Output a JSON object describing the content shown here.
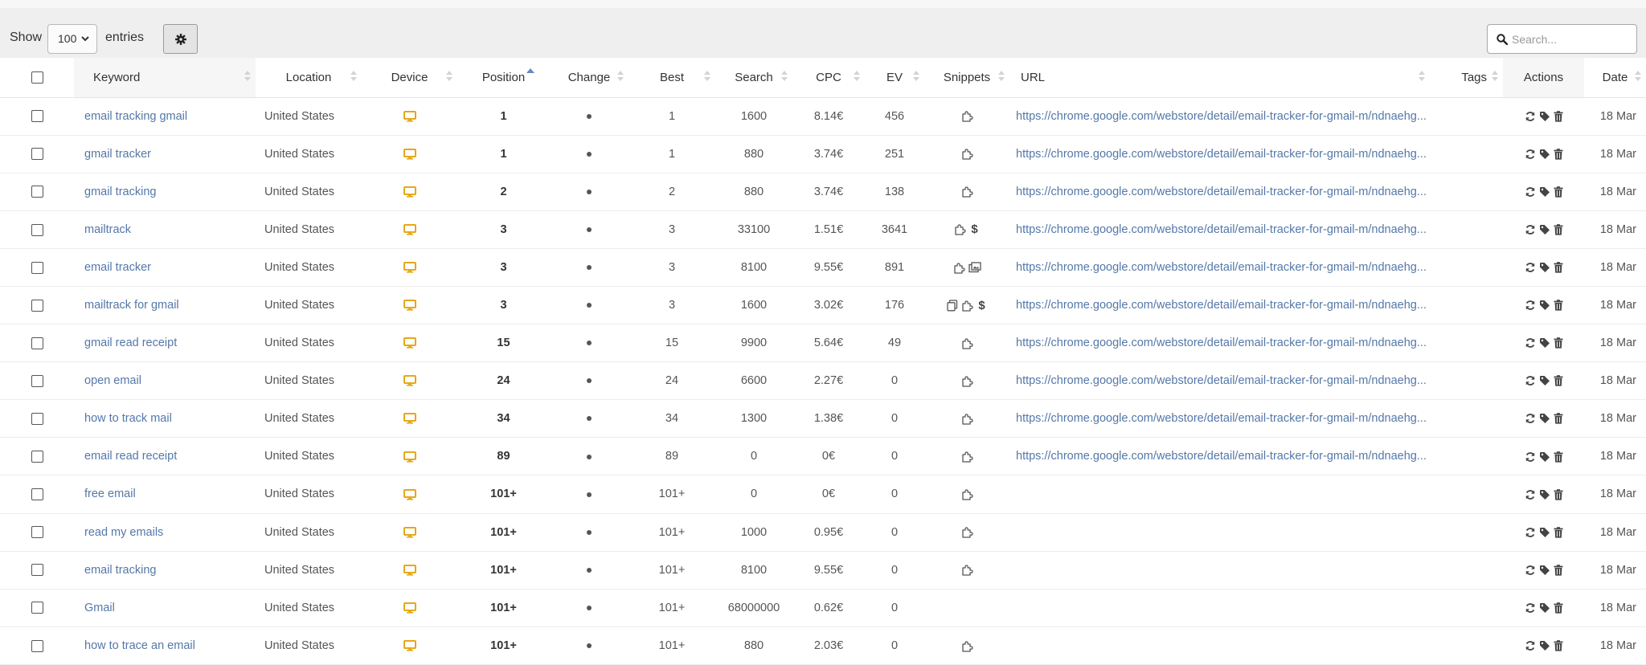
{
  "toolbar": {
    "show_label": "Show",
    "entries_value": "100",
    "entries_label": "entries",
    "settings_icon": "gear-icon",
    "search_placeholder": "Search..."
  },
  "columns": {
    "keyword": "Keyword",
    "location": "Location",
    "device": "Device",
    "position": "Position",
    "change": "Change",
    "best": "Best",
    "search": "Search",
    "cpc": "CPC",
    "ev": "EV",
    "snippets": "Snippets",
    "url": "URL",
    "tags": "Tags",
    "actions": "Actions",
    "date": "Date"
  },
  "colors": {
    "link": "#5478a8",
    "device_icon": "#e6a817",
    "sort_active": "#6c88c3"
  },
  "rows": [
    {
      "keyword": "email tracking gmail",
      "location": "United States",
      "device": "desktop-icon",
      "position": "1",
      "change": "dot",
      "best": "1",
      "search": "1600",
      "cpc": "8.14€",
      "ev": "456",
      "snippets": [
        "puzzle-icon"
      ],
      "url": "https://chrome.google.com/webstore/detail/email-tracker-for-gmail-m/ndnaehg...",
      "date": "18 Mar"
    },
    {
      "keyword": "gmail tracker",
      "location": "United States",
      "device": "desktop-icon",
      "position": "1",
      "change": "dot",
      "best": "1",
      "search": "880",
      "cpc": "3.74€",
      "ev": "251",
      "snippets": [
        "puzzle-icon"
      ],
      "url": "https://chrome.google.com/webstore/detail/email-tracker-for-gmail-m/ndnaehg...",
      "date": "18 Mar"
    },
    {
      "keyword": "gmail tracking",
      "location": "United States",
      "device": "desktop-icon",
      "position": "2",
      "change": "dot",
      "best": "2",
      "search": "880",
      "cpc": "3.74€",
      "ev": "138",
      "snippets": [
        "puzzle-icon"
      ],
      "url": "https://chrome.google.com/webstore/detail/email-tracker-for-gmail-m/ndnaehg...",
      "date": "18 Mar"
    },
    {
      "keyword": "mailtrack",
      "location": "United States",
      "device": "desktop-icon",
      "position": "3",
      "change": "dot",
      "best": "3",
      "search": "33100",
      "cpc": "1.51€",
      "ev": "3641",
      "snippets": [
        "puzzle-icon",
        "dollar-icon"
      ],
      "url": "https://chrome.google.com/webstore/detail/email-tracker-for-gmail-m/ndnaehg...",
      "date": "18 Mar"
    },
    {
      "keyword": "email tracker",
      "location": "United States",
      "device": "desktop-icon",
      "position": "3",
      "change": "dot",
      "best": "3",
      "search": "8100",
      "cpc": "9.55€",
      "ev": "891",
      "snippets": [
        "puzzle-icon",
        "images-icon"
      ],
      "url": "https://chrome.google.com/webstore/detail/email-tracker-for-gmail-m/ndnaehg...",
      "date": "18 Mar"
    },
    {
      "keyword": "mailtrack for gmail",
      "location": "United States",
      "device": "desktop-icon",
      "position": "3",
      "change": "dot",
      "best": "3",
      "search": "1600",
      "cpc": "3.02€",
      "ev": "176",
      "snippets": [
        "copy-icon",
        "puzzle-icon",
        "dollar-icon"
      ],
      "url": "https://chrome.google.com/webstore/detail/email-tracker-for-gmail-m/ndnaehg...",
      "date": "18 Mar"
    },
    {
      "keyword": "gmail read receipt",
      "location": "United States",
      "device": "desktop-icon",
      "position": "15",
      "change": "dot",
      "best": "15",
      "search": "9900",
      "cpc": "5.64€",
      "ev": "49",
      "snippets": [
        "puzzle-icon"
      ],
      "url": "https://chrome.google.com/webstore/detail/email-tracker-for-gmail-m/ndnaehg...",
      "date": "18 Mar"
    },
    {
      "keyword": "open email",
      "location": "United States",
      "device": "desktop-icon",
      "position": "24",
      "change": "dot",
      "best": "24",
      "search": "6600",
      "cpc": "2.27€",
      "ev": "0",
      "snippets": [
        "puzzle-icon"
      ],
      "url": "https://chrome.google.com/webstore/detail/email-tracker-for-gmail-m/ndnaehg...",
      "date": "18 Mar"
    },
    {
      "keyword": "how to track mail",
      "location": "United States",
      "device": "desktop-icon",
      "position": "34",
      "change": "dot",
      "best": "34",
      "search": "1300",
      "cpc": "1.38€",
      "ev": "0",
      "snippets": [
        "puzzle-icon"
      ],
      "url": "https://chrome.google.com/webstore/detail/email-tracker-for-gmail-m/ndnaehg...",
      "date": "18 Mar"
    },
    {
      "keyword": "email read receipt",
      "location": "United States",
      "device": "desktop-icon",
      "position": "89",
      "change": "dot",
      "best": "89",
      "search": "0",
      "cpc": "0€",
      "ev": "0",
      "snippets": [
        "puzzle-icon"
      ],
      "url": "https://chrome.google.com/webstore/detail/email-tracker-for-gmail-m/ndnaehg...",
      "date": "18 Mar"
    },
    {
      "keyword": "free email",
      "location": "United States",
      "device": "desktop-icon",
      "position": "101+",
      "change": "dot",
      "best": "101+",
      "search": "0",
      "cpc": "0€",
      "ev": "0",
      "snippets": [
        "puzzle-icon"
      ],
      "url": "",
      "date": "18 Mar"
    },
    {
      "keyword": "read my emails",
      "location": "United States",
      "device": "desktop-icon",
      "position": "101+",
      "change": "dot",
      "best": "101+",
      "search": "1000",
      "cpc": "0.95€",
      "ev": "0",
      "snippets": [
        "puzzle-icon"
      ],
      "url": "",
      "date": "18 Mar"
    },
    {
      "keyword": "email tracking",
      "location": "United States",
      "device": "desktop-icon",
      "position": "101+",
      "change": "dot",
      "best": "101+",
      "search": "8100",
      "cpc": "9.55€",
      "ev": "0",
      "snippets": [
        "puzzle-icon"
      ],
      "url": "",
      "date": "18 Mar"
    },
    {
      "keyword": "Gmail",
      "location": "United States",
      "device": "desktop-icon",
      "position": "101+",
      "change": "dot",
      "best": "101+",
      "search": "68000000",
      "cpc": "0.62€",
      "ev": "0",
      "snippets": [],
      "url": "",
      "date": "18 Mar"
    },
    {
      "keyword": "how to trace an email",
      "location": "United States",
      "device": "desktop-icon",
      "position": "101+",
      "change": "dot",
      "best": "101+",
      "search": "880",
      "cpc": "2.03€",
      "ev": "0",
      "snippets": [
        "puzzle-icon"
      ],
      "url": "",
      "date": "18 Mar"
    }
  ],
  "row_actions": [
    "refresh-icon",
    "tag-icon",
    "trash-icon"
  ]
}
